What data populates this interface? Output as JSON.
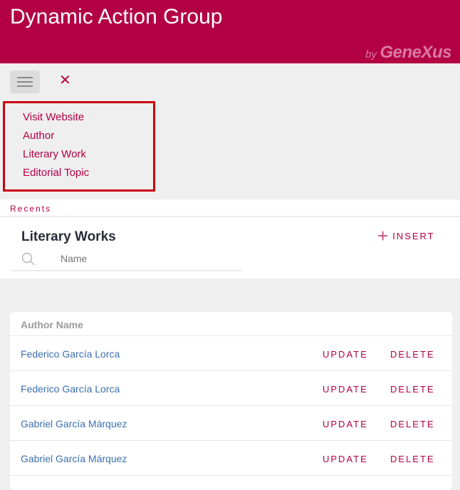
{
  "header": {
    "title": "Dynamic Action Group",
    "brand_by": "by",
    "brand_name": "GeneXus"
  },
  "toolbar": {
    "menu_icon": "hamburger-icon",
    "close_icon": "close-icon",
    "close_glyph": "✕"
  },
  "menu": {
    "items": [
      {
        "label": "Visit Website"
      },
      {
        "label": "Author"
      },
      {
        "label": "Literary Work"
      },
      {
        "label": "Editorial Topic"
      }
    ]
  },
  "recents": {
    "label": "Recents"
  },
  "panel": {
    "title": "Literary Works",
    "insert_label": "INSERT",
    "insert_glyph": "+",
    "search_placeholder": "Name",
    "search_value": ""
  },
  "grid": {
    "columns": [
      "Author Name"
    ],
    "update_label": "UPDATE",
    "delete_label": "DELETE",
    "rows": [
      {
        "author": "Federico García Lorca"
      },
      {
        "author": "Federico García Lorca"
      },
      {
        "author": "Gabriel García Márquez"
      },
      {
        "author": "Gabriel García Márquez"
      }
    ]
  },
  "colors": {
    "brand": "#b30045",
    "link": "#3c6fb0",
    "highlight_border": "#c8000f"
  }
}
